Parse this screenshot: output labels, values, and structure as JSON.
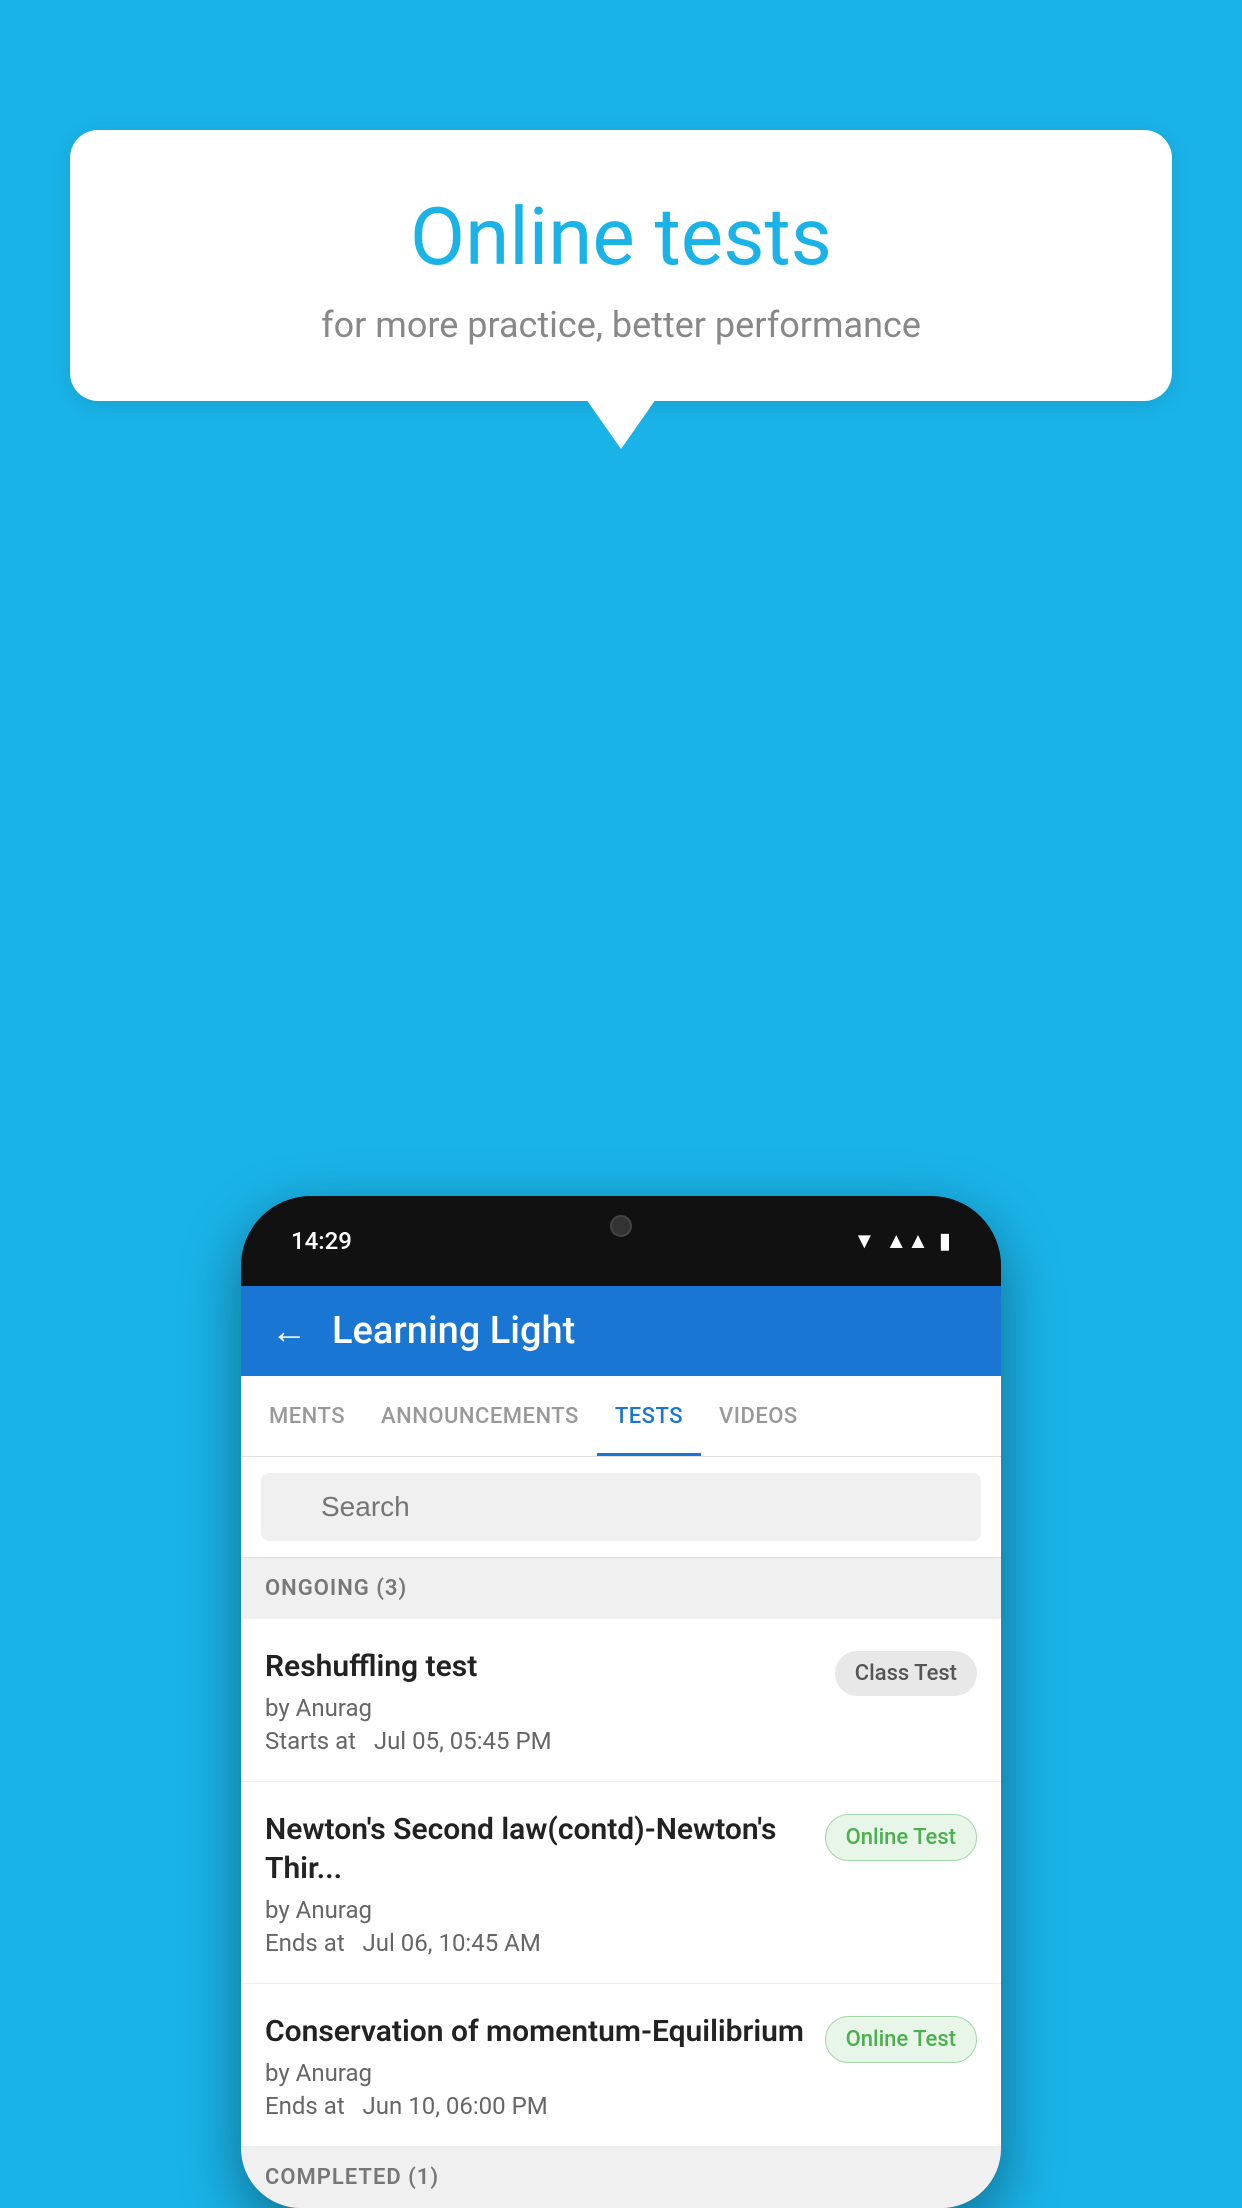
{
  "background": {
    "color": "#1ab3e8"
  },
  "speech_bubble": {
    "title": "Online tests",
    "subtitle": "for more practice, better performance"
  },
  "phone": {
    "status_bar": {
      "time": "14:29"
    },
    "header": {
      "app_name": "Learning Light",
      "back_label": "←"
    },
    "tabs": [
      {
        "label": "MENTS",
        "active": false
      },
      {
        "label": "ANNOUNCEMENTS",
        "active": false
      },
      {
        "label": "TESTS",
        "active": true
      },
      {
        "label": "VIDEOS",
        "active": false
      }
    ],
    "search": {
      "placeholder": "Search"
    },
    "sections": [
      {
        "title": "ONGOING (3)",
        "tests": [
          {
            "title": "Reshuffling test",
            "author": "by Anurag",
            "date": "Starts at  Jul 05, 05:45 PM",
            "badge": "Class Test",
            "badge_type": "class"
          },
          {
            "title": "Newton's Second law(contd)-Newton's Thir...",
            "author": "by Anurag",
            "date": "Ends at  Jul 06, 10:45 AM",
            "badge": "Online Test",
            "badge_type": "online"
          },
          {
            "title": "Conservation of momentum-Equilibrium",
            "author": "by Anurag",
            "date": "Ends at  Jun 10, 06:00 PM",
            "badge": "Online Test",
            "badge_type": "online"
          }
        ]
      },
      {
        "title": "COMPLETED (1)",
        "tests": []
      }
    ]
  }
}
